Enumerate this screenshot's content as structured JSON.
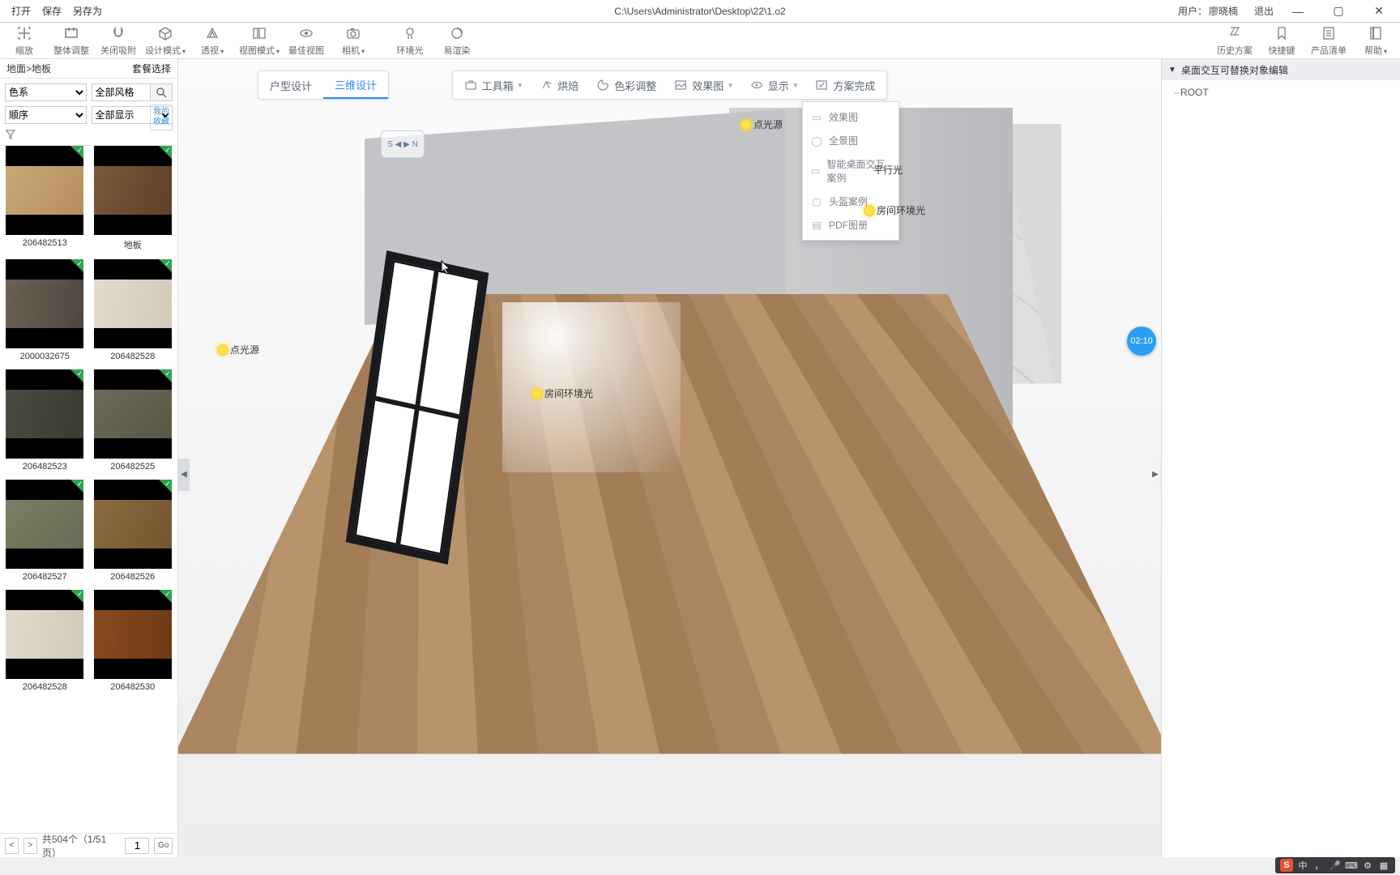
{
  "titlebar": {
    "menu": {
      "open": "打开",
      "save": "保存",
      "saveas": "另存为"
    },
    "path": "C:\\Users\\Administrator\\Desktop\\22\\1.o2",
    "user_label": "用户：",
    "user_name": "廖晓楠",
    "logout": "退出",
    "min": "—",
    "max": "▢",
    "close": "✕"
  },
  "ribbon": {
    "tools": [
      {
        "label": "缩放",
        "caret": false
      },
      {
        "label": "整体调整",
        "caret": false
      },
      {
        "label": "关闭吸附",
        "caret": false
      },
      {
        "label": "设计模式",
        "caret": true
      },
      {
        "label": "透视",
        "caret": true
      },
      {
        "label": "视图模式",
        "caret": true
      },
      {
        "label": "最佳视图",
        "caret": false
      },
      {
        "label": "相机",
        "caret": true
      },
      {
        "label": "环境光",
        "caret": false
      },
      {
        "label": "易渲染",
        "caret": false
      }
    ],
    "rtools": [
      {
        "label": "历史方案"
      },
      {
        "label": "快捷键"
      },
      {
        "label": "产品清单"
      },
      {
        "label": "帮助",
        "caret": true
      }
    ]
  },
  "breadcrumb": {
    "path": "地面>地板",
    "setchoice": "套餐选择"
  },
  "filters": {
    "colorscheme": "色系",
    "allstyle": "全部风格",
    "sort": "顺序",
    "alldisplay": "全部显示",
    "fav_l1": "我的",
    "fav_l2": "收藏"
  },
  "thumbs": [
    {
      "id": "206482513",
      "tex": "linear-gradient(120deg,#caa778,#b58e5f)"
    },
    {
      "id": "地板",
      "tex": "linear-gradient(110deg,#7a5a3a,#5d4028)"
    },
    {
      "id": "2000032675",
      "tex": "linear-gradient(100deg,#6b6055,#4f463e)"
    },
    {
      "id": "206482528",
      "tex": "linear-gradient(100deg,#e3dbce,#d2c9ba)"
    },
    {
      "id": "206482523",
      "tex": "linear-gradient(100deg,#4b4a40,#3b3a32)"
    },
    {
      "id": "206482525",
      "tex": "linear-gradient(135deg,#6d6a57,#5a5746)"
    },
    {
      "id": "206482527",
      "tex": "linear-gradient(135deg,#7b7d64,#696b54)"
    },
    {
      "id": "206482526",
      "tex": "linear-gradient(115deg,#8b6b3f,#745630)"
    },
    {
      "id": "206482528",
      "tex": "linear-gradient(100deg,#e3dbce,#d2c9ba)"
    },
    {
      "id": "206482530",
      "tex": "linear-gradient(100deg,#8a4a20,#6e3916)"
    }
  ],
  "pager": {
    "prev": "<",
    "next": ">",
    "total": "共504个（1/51页）",
    "page_input": "1",
    "go": "Go"
  },
  "tabs": {
    "plan": "户型设计",
    "three": "三维设计"
  },
  "vtop": {
    "toolbox": "工具箱",
    "bake": "烘焙",
    "color": "色彩调整",
    "render": "效果图",
    "display": "显示",
    "done": "方案完成"
  },
  "dropdown": {
    "items": [
      "效果图",
      "全景图",
      "智能桌面交互案例",
      "头盔案例",
      "PDF图册"
    ]
  },
  "lights": {
    "point1": "点光源",
    "point2": "点光源",
    "parallel": "平行光",
    "ambient1": "房间环境光",
    "ambient2": "房间环境光"
  },
  "timer": "02:10",
  "compass": "S ◀ ▶ N",
  "rightpanel": {
    "title": "桌面交互可替换对象编辑",
    "root": "ROOT"
  },
  "taskstrip": {
    "ime": "中",
    "punct": "，",
    "mic": "🎤",
    "kbd": "⌨",
    "cfg": "⚙",
    "app": "▦"
  }
}
